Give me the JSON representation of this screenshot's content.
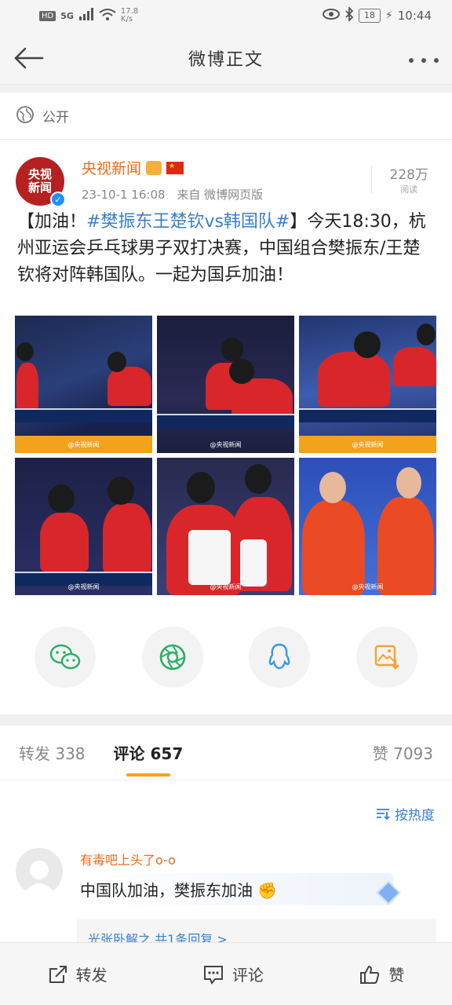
{
  "status_bar": {
    "hd": "HD",
    "network": "5G",
    "speed_value": "17.8",
    "speed_unit": "K/s",
    "battery": "18",
    "time": "10:44"
  },
  "nav": {
    "title": "微博正文"
  },
  "visibility": {
    "label": "公开"
  },
  "author": {
    "avatar_text_line1": "央视",
    "avatar_text_line2": "新闻",
    "name": "央视新闻",
    "time": "23-10-1 16:08",
    "source": "来自 微博网页版",
    "reads_count": "228万",
    "reads_label": "阅读"
  },
  "post": {
    "open": "【加油！",
    "hashtag": "#樊振东王楚钦vs韩国队#",
    "body": "】今天18:30，杭州亚运会乒乓球男子双打决赛，中国组合樊振东/王楚钦将对阵韩国队。一起为国乒加油！"
  },
  "photos": [
    {
      "watermark": "@央视新闻"
    },
    {
      "watermark": "@央视新闻"
    },
    {
      "watermark": "@央视新闻"
    },
    {
      "watermark": "@央视新闻"
    },
    {
      "watermark": "@央视新闻"
    },
    {
      "watermark": "@央视新闻"
    }
  ],
  "share": [
    {
      "icon": "wechat-icon",
      "color": "#2aae67"
    },
    {
      "icon": "moments-icon",
      "color": "#2aae67"
    },
    {
      "icon": "qq-icon",
      "color": "#3a97e6"
    },
    {
      "icon": "save-image-icon",
      "color": "#f3a32d"
    }
  ],
  "tabs": {
    "repost_label": "转发",
    "repost_count": "338",
    "comment_label": "评论",
    "comment_count": "657",
    "like_label": "赞",
    "like_count": "7093"
  },
  "sort": {
    "label": "按热度"
  },
  "comment": {
    "user": "有毒吧上头了o-o",
    "text": "中国队加油，樊振东加油",
    "replies": "光张卧解之 共1条回复 >"
  },
  "bottom_bar": {
    "repost": "转发",
    "comment": "评论",
    "like": "赞"
  },
  "colors": {
    "accent": "#f7a020",
    "link": "#3a7fc8",
    "username": "#e86b1c"
  }
}
